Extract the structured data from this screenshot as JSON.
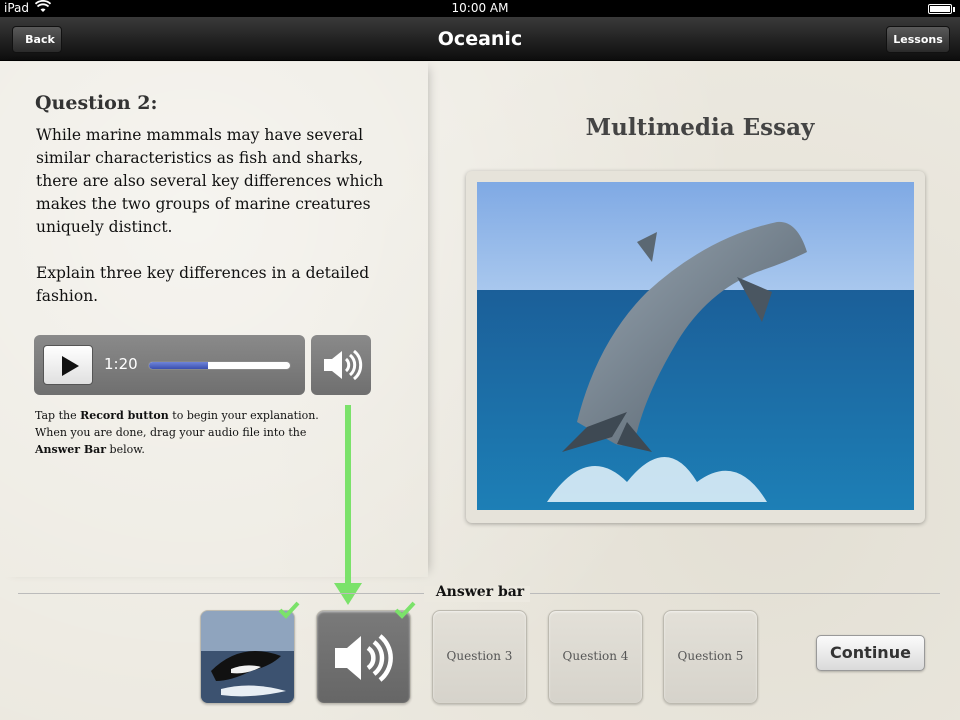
{
  "status_bar": {
    "carrier": "iPad",
    "time": "10:00 AM"
  },
  "nav": {
    "back_label": "Back",
    "title": "Oceanic",
    "lessons_label": "Lessons"
  },
  "question": {
    "title": "Question 2:",
    "paragraph1": "While marine mammals may have several similar characteristics as fish and sharks, there are also several key differences which makes the two groups of marine creatures uniquely distinct.",
    "paragraph2": "Explain three key differences in a detailed fashion."
  },
  "player": {
    "time": "1:20",
    "progress_fraction": 0.42
  },
  "instructions": {
    "part1": "Tap the ",
    "bold1": "Record button",
    "part2": " to begin your explanation. When you are done, drag your audio file into the ",
    "bold2": "Answer Bar",
    "part3": " below."
  },
  "essay": {
    "title": "Multimedia Essay"
  },
  "answer_bar": {
    "label": "Answer bar",
    "slots": [
      {
        "type": "image",
        "completed": true
      },
      {
        "type": "audio",
        "completed": true
      },
      {
        "type": "empty",
        "label": "Question 3"
      },
      {
        "type": "empty",
        "label": "Question 4"
      },
      {
        "type": "empty",
        "label": "Question 5"
      }
    ]
  },
  "continue_label": "Continue",
  "colors": {
    "accent_green": "#7be26a",
    "progress_blue": "#3a4fb0",
    "nav_dark": "#0d0d0d"
  }
}
